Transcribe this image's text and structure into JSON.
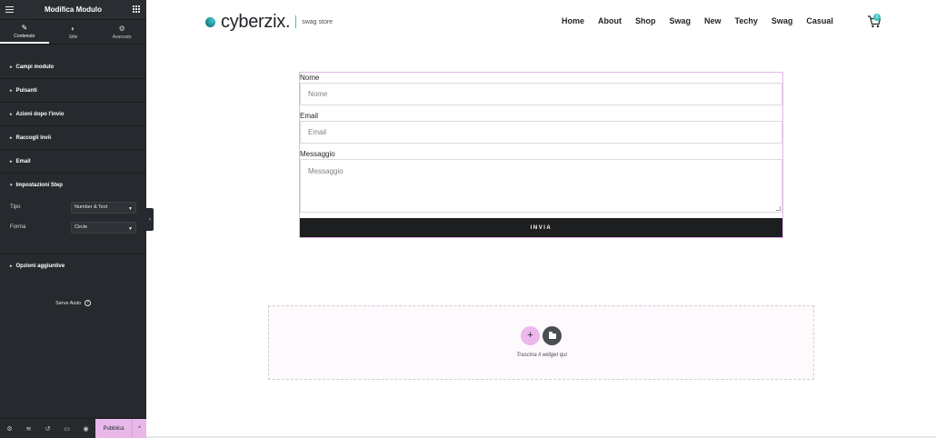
{
  "panel": {
    "title": "Modifica Modulo",
    "tabs": [
      {
        "label": "Contenuto",
        "icon": "pencil-icon",
        "glyph": "✎"
      },
      {
        "label": "Stile",
        "icon": "contrast-icon",
        "glyph": "◐"
      },
      {
        "label": "Avanzato",
        "icon": "gear-icon",
        "glyph": "⚙"
      }
    ],
    "sections": [
      {
        "label": "Campi modulo"
      },
      {
        "label": "Pulsanti"
      },
      {
        "label": "Azioni dopo l'invio"
      },
      {
        "label": "Raccogli Invii"
      },
      {
        "label": "Email"
      },
      {
        "label": "Impostazioni Step"
      }
    ],
    "controls": {
      "tipo_label": "Tipo",
      "tipo_value": "Number & Text",
      "forma_label": "Forma",
      "forma_value": "Circle"
    },
    "extra_section": "Opzioni aggiuntive",
    "help_text": "Serve Aiuto",
    "footer": {
      "publish_label": "Pubblica"
    }
  },
  "site": {
    "logo_text": "cyberzix.",
    "logo_sub": "swag store",
    "nav": [
      "Home",
      "About",
      "Shop",
      "Swag",
      "New",
      "Techy",
      "Swag",
      "Casual"
    ],
    "cart_count": "0"
  },
  "form": {
    "name_label": "Nome",
    "name_placeholder": "Nome",
    "email_label": "Email",
    "email_placeholder": "Email",
    "message_label": "Messaggio",
    "message_placeholder": "Messaggio",
    "submit_label": "INVIA"
  },
  "dropzone": {
    "text": "Trascina il widget qui"
  },
  "colors": {
    "panel_bg": "#26292d",
    "accent_pink": "#e7b8e8",
    "brand_teal": "#3fc3c4"
  }
}
